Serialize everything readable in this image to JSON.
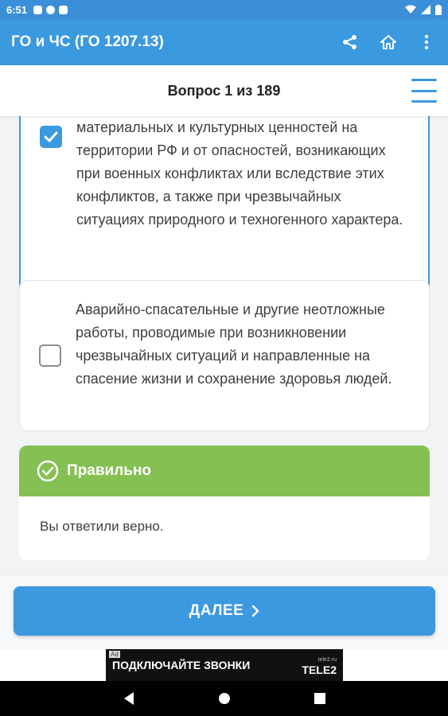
{
  "status_bar": {
    "time": "6:51"
  },
  "app_bar": {
    "title": "ГО и ЧС (ГО 1207.13)",
    "actions": [
      "share-icon",
      "home-icon",
      "more-vert-icon"
    ]
  },
  "question": {
    "title": "Вопрос 1 из 189"
  },
  "answers": [
    {
      "checked": true,
      "text": "материальных и культурных ценностей на территории РФ и от опасностей, возникающих при военных конфликтах или вследствие этих конфликтов, а также при чрезвычайных ситуациях природного и техногенного характера."
    },
    {
      "checked": false,
      "text": "Аварийно-спасательные и другие неотложные работы, проводимые при возникновении чрезвычайных ситуаций и направленные на спасение жизни и сохранение здоровья людей."
    }
  ],
  "result": {
    "title": "Правильно",
    "message": "Вы ответили верно.",
    "color": "#85c052"
  },
  "next_button": {
    "label": "ДАЛЕЕ"
  },
  "ad": {
    "mark": "Ad",
    "text": "ПОДКЛЮЧАЙТЕ ЗВОНКИ",
    "brand": "TELE2",
    "brand_small": "tele2.ru"
  },
  "colors": {
    "accent": "#3b99e0",
    "success": "#85c052"
  }
}
